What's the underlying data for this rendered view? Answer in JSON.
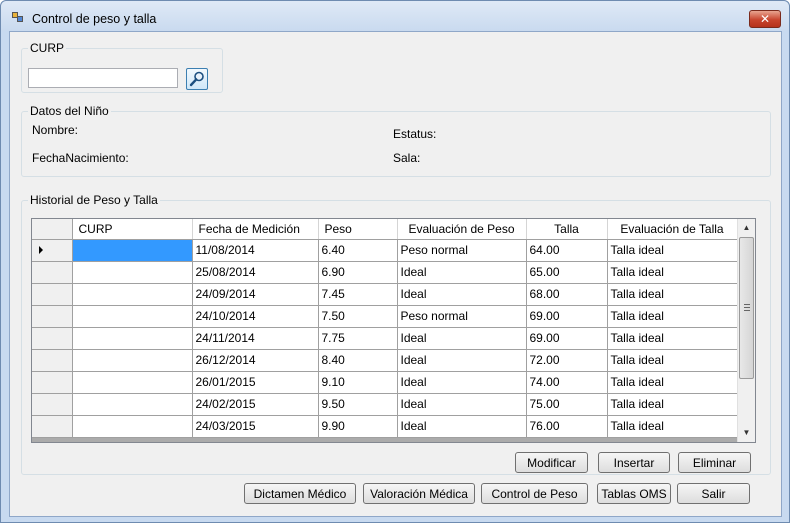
{
  "window": {
    "title": "Control de peso y talla",
    "close_glyph": "✕"
  },
  "curp_group": {
    "legend": "CURP",
    "input_value": ""
  },
  "datos_group": {
    "legend": "Datos del Niño",
    "nombre_label": "Nombre:",
    "fecha_label": "FechaNacimiento:",
    "estatus_label": "Estatus:",
    "sala_label": "Sala:"
  },
  "historial_group": {
    "legend": "Historial de Peso y Talla",
    "columns": [
      "CURP",
      "Fecha de Medición",
      "Peso",
      "Evaluación de Peso",
      "Talla",
      "Evaluación de Talla"
    ],
    "rows": [
      {
        "curp": "",
        "fecha": "11/08/2014",
        "peso": "6.40",
        "eval_peso": "Peso normal",
        "talla": "64.00",
        "eval_talla": "Talla ideal"
      },
      {
        "curp": "",
        "fecha": "25/08/2014",
        "peso": "6.90",
        "eval_peso": "Ideal",
        "talla": "65.00",
        "eval_talla": "Talla ideal"
      },
      {
        "curp": "",
        "fecha": "24/09/2014",
        "peso": "7.45",
        "eval_peso": "Ideal",
        "talla": "68.00",
        "eval_talla": "Talla ideal"
      },
      {
        "curp": "",
        "fecha": "24/10/2014",
        "peso": "7.50",
        "eval_peso": "Peso normal",
        "talla": "69.00",
        "eval_talla": "Talla ideal"
      },
      {
        "curp": "",
        "fecha": "24/11/2014",
        "peso": "7.75",
        "eval_peso": "Ideal",
        "talla": "69.00",
        "eval_talla": "Talla ideal"
      },
      {
        "curp": "",
        "fecha": "26/12/2014",
        "peso": "8.40",
        "eval_peso": "Ideal",
        "talla": "72.00",
        "eval_talla": "Talla ideal"
      },
      {
        "curp": "",
        "fecha": "26/01/2015",
        "peso": "9.10",
        "eval_peso": "Ideal",
        "talla": "74.00",
        "eval_talla": "Talla ideal"
      },
      {
        "curp": "",
        "fecha": "24/02/2015",
        "peso": "9.50",
        "eval_peso": "Ideal",
        "talla": "75.00",
        "eval_talla": "Talla ideal"
      },
      {
        "curp": "",
        "fecha": "24/03/2015",
        "peso": "9.90",
        "eval_peso": "Ideal",
        "talla": "76.00",
        "eval_talla": "Talla ideal"
      }
    ],
    "selected_row": 0,
    "scroll": {
      "up_glyph": "▲",
      "down_glyph": "▼"
    }
  },
  "grid_buttons": {
    "modificar": "Modificar",
    "insertar": "Insertar",
    "eliminar": "Eliminar"
  },
  "bottom_buttons": {
    "dictamen": "Dictamen Médico",
    "valoracion": "Valoración Médica",
    "control": "Control de Peso",
    "tablas": "Tablas OMS",
    "salir": "Salir"
  },
  "icons": {
    "app": "window-app-icon",
    "search": "magnifier-icon"
  },
  "colors": {
    "selection": "#3399ff",
    "titlebar": "#c9daef"
  }
}
